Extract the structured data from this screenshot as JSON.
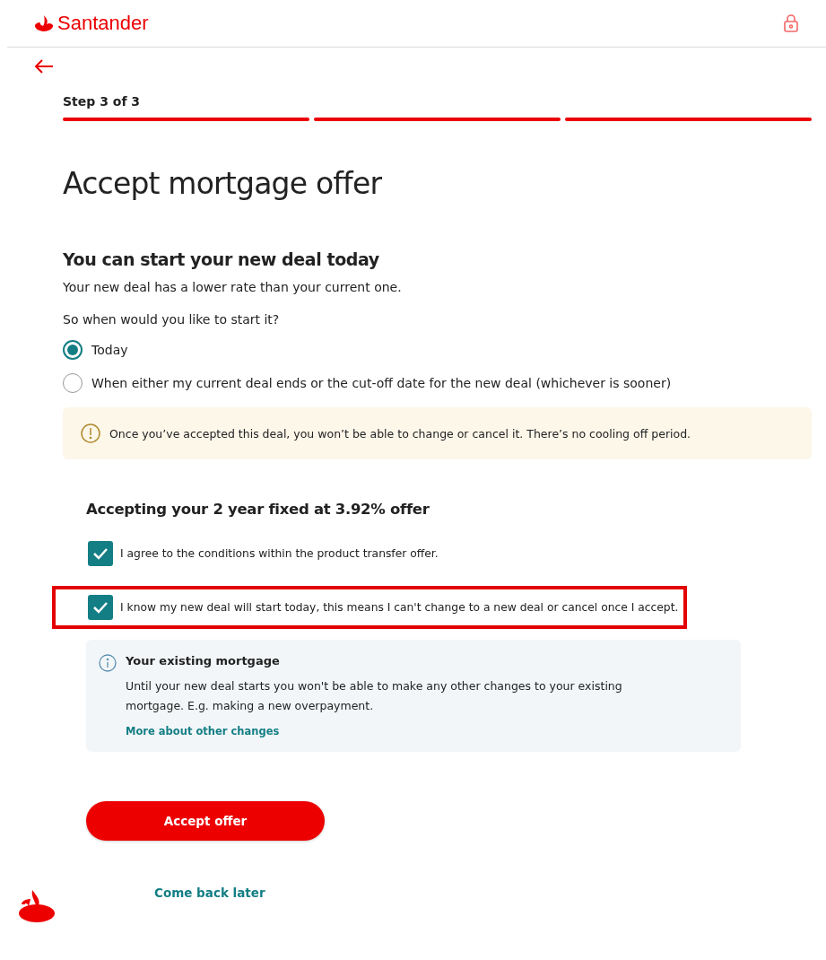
{
  "header": {
    "brand": "Santander"
  },
  "progress": {
    "label": "Step 3 of 3",
    "steps": [
      {
        "done": true
      },
      {
        "done": true
      },
      {
        "done": true
      }
    ]
  },
  "title": "Accept mortgage offer",
  "start_section": {
    "heading": "You can start your new deal today",
    "text": "Your new deal has a lower rate than your current one.",
    "question": "So when would you like to start it?",
    "options": [
      {
        "label": "Today",
        "selected": true
      },
      {
        "label": "When either my current deal ends or the cut-off date for the new deal (whichever is sooner)",
        "selected": false
      }
    ]
  },
  "warning": "Once you’ve accepted this deal, you won’t be able to change or cancel it. There’s no cooling off period.",
  "accept_section": {
    "heading": "Accepting your 2 year fixed at 3.92% offer",
    "checkboxes": [
      {
        "label": "I agree to the conditions within the product transfer offer.",
        "checked": true,
        "highlighted": false
      },
      {
        "label": "I know my new deal will start today, this means I can't change to a new deal or cancel once I accept.",
        "checked": true,
        "highlighted": true
      }
    ]
  },
  "info": {
    "title": "Your existing mortgage",
    "text": "Until your new deal starts you won't be able to make any other changes to your existing mortgage. E.g. making a new overpayment.",
    "link": "More about other changes"
  },
  "buttons": {
    "primary": "Accept offer",
    "secondary": "Come back later"
  }
}
